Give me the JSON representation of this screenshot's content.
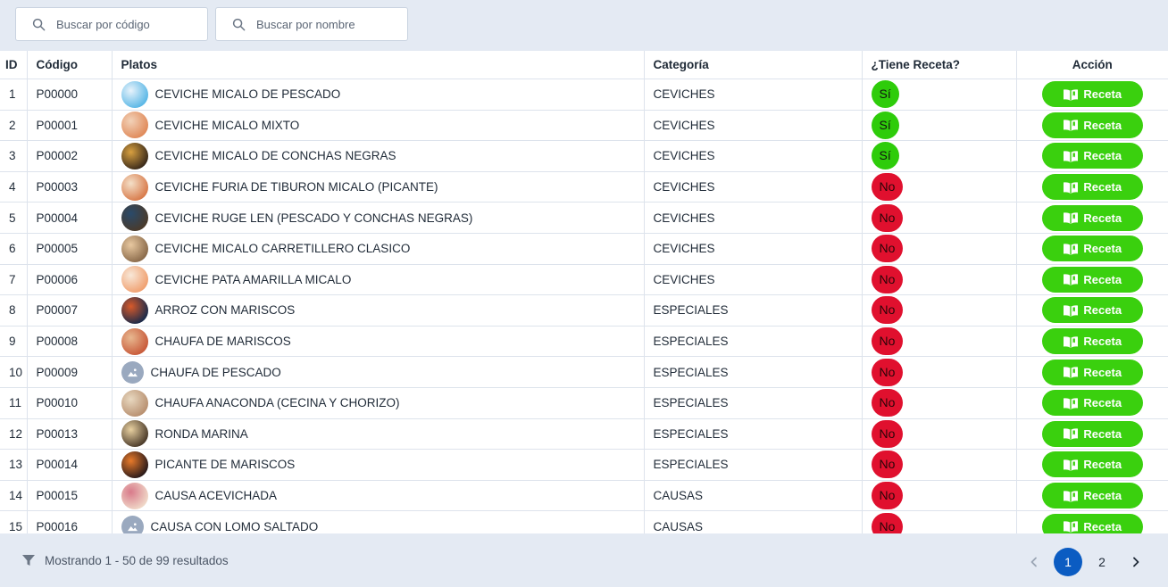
{
  "search": {
    "code_placeholder": "Buscar por código",
    "name_placeholder": "Buscar por nombre"
  },
  "table": {
    "headers": {
      "id": "ID",
      "code": "Código",
      "plato": "Platos",
      "category": "Categoría",
      "recipe": "¿Tiene Receta?",
      "action": "Acción"
    },
    "action_label": "Receta",
    "rows": [
      {
        "id": "1",
        "code": "P00000",
        "name": "CEVICHE MICALO DE PESCADO",
        "category": "CEVICHES",
        "recipe": "Sí",
        "thumb": "photo"
      },
      {
        "id": "2",
        "code": "P00001",
        "name": "CEVICHE MICALO MIXTO",
        "category": "CEVICHES",
        "recipe": "Sí",
        "thumb": "photo"
      },
      {
        "id": "3",
        "code": "P00002",
        "name": "CEVICHE MICALO DE CONCHAS NEGRAS",
        "category": "CEVICHES",
        "recipe": "Sí",
        "thumb": "photo"
      },
      {
        "id": "4",
        "code": "P00003",
        "name": "CEVICHE FURIA DE TIBURON MICALO (PICANTE)",
        "category": "CEVICHES",
        "recipe": "No",
        "thumb": "photo"
      },
      {
        "id": "5",
        "code": "P00004",
        "name": "CEVICHE RUGE LEN (PESCADO Y CONCHAS NEGRAS)",
        "category": "CEVICHES",
        "recipe": "No",
        "thumb": "photo"
      },
      {
        "id": "6",
        "code": "P00005",
        "name": "CEVICHE MICALO CARRETILLERO CLASICO",
        "category": "CEVICHES",
        "recipe": "No",
        "thumb": "photo"
      },
      {
        "id": "7",
        "code": "P00006",
        "name": "CEVICHE PATA AMARILLA MICALO",
        "category": "CEVICHES",
        "recipe": "No",
        "thumb": "photo"
      },
      {
        "id": "8",
        "code": "P00007",
        "name": "ARROZ CON MARISCOS",
        "category": "ESPECIALES",
        "recipe": "No",
        "thumb": "photo"
      },
      {
        "id": "9",
        "code": "P00008",
        "name": "CHAUFA DE MARISCOS",
        "category": "ESPECIALES",
        "recipe": "No",
        "thumb": "photo"
      },
      {
        "id": "10",
        "code": "P00009",
        "name": "CHAUFA DE PESCADO",
        "category": "ESPECIALES",
        "recipe": "No",
        "thumb": "placeholder"
      },
      {
        "id": "11",
        "code": "P00010",
        "name": "CHAUFA ANACONDA (CECINA Y CHORIZO)",
        "category": "ESPECIALES",
        "recipe": "No",
        "thumb": "photo"
      },
      {
        "id": "12",
        "code": "P00013",
        "name": "RONDA MARINA",
        "category": "ESPECIALES",
        "recipe": "No",
        "thumb": "photo"
      },
      {
        "id": "13",
        "code": "P00014",
        "name": "PICANTE DE MARISCOS",
        "category": "ESPECIALES",
        "recipe": "No",
        "thumb": "photo"
      },
      {
        "id": "14",
        "code": "P00015",
        "name": "CAUSA ACEVICHADA",
        "category": "CAUSAS",
        "recipe": "No",
        "thumb": "photo"
      },
      {
        "id": "15",
        "code": "P00016",
        "name": "CAUSA CON LOMO SALTADO",
        "category": "CAUSAS",
        "recipe": "No",
        "thumb": "placeholder"
      }
    ]
  },
  "footer": {
    "results_text": "Mostrando 1 - 50 de 99 resultados",
    "pages": [
      "1",
      "2"
    ],
    "active_page": "1"
  },
  "colors": {
    "yes": "#2ecc0a",
    "no": "#e0102e",
    "action": "#3ad00e",
    "active_page": "#0b5cc2"
  }
}
